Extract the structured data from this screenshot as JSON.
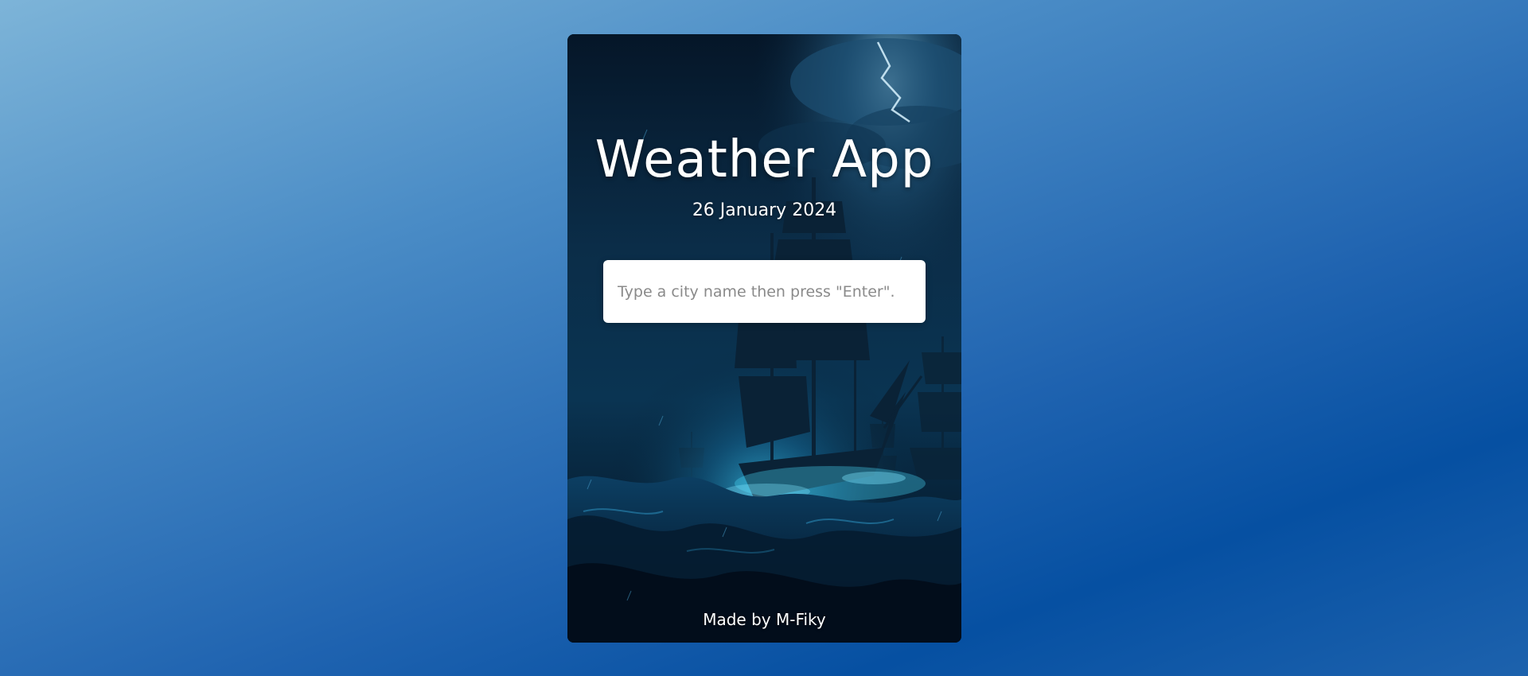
{
  "app": {
    "title": "Weather App",
    "date": "26 January 2024"
  },
  "search": {
    "placeholder": "Type a city name then press \"Enter\".",
    "value": ""
  },
  "footer": {
    "credit": "Made by M-Fiky"
  },
  "background": {
    "subject": "ship-in-storm-illustration"
  },
  "colors": {
    "page_gradient": [
      "#7db4d8",
      "#4a8cc6",
      "#1f63b0",
      "#0650a2"
    ],
    "card_dark": "#03101f",
    "glow": "#39c4f0",
    "text": "#ffffff",
    "input_bg": "#ffffff",
    "placeholder": "#8a8a8a"
  }
}
